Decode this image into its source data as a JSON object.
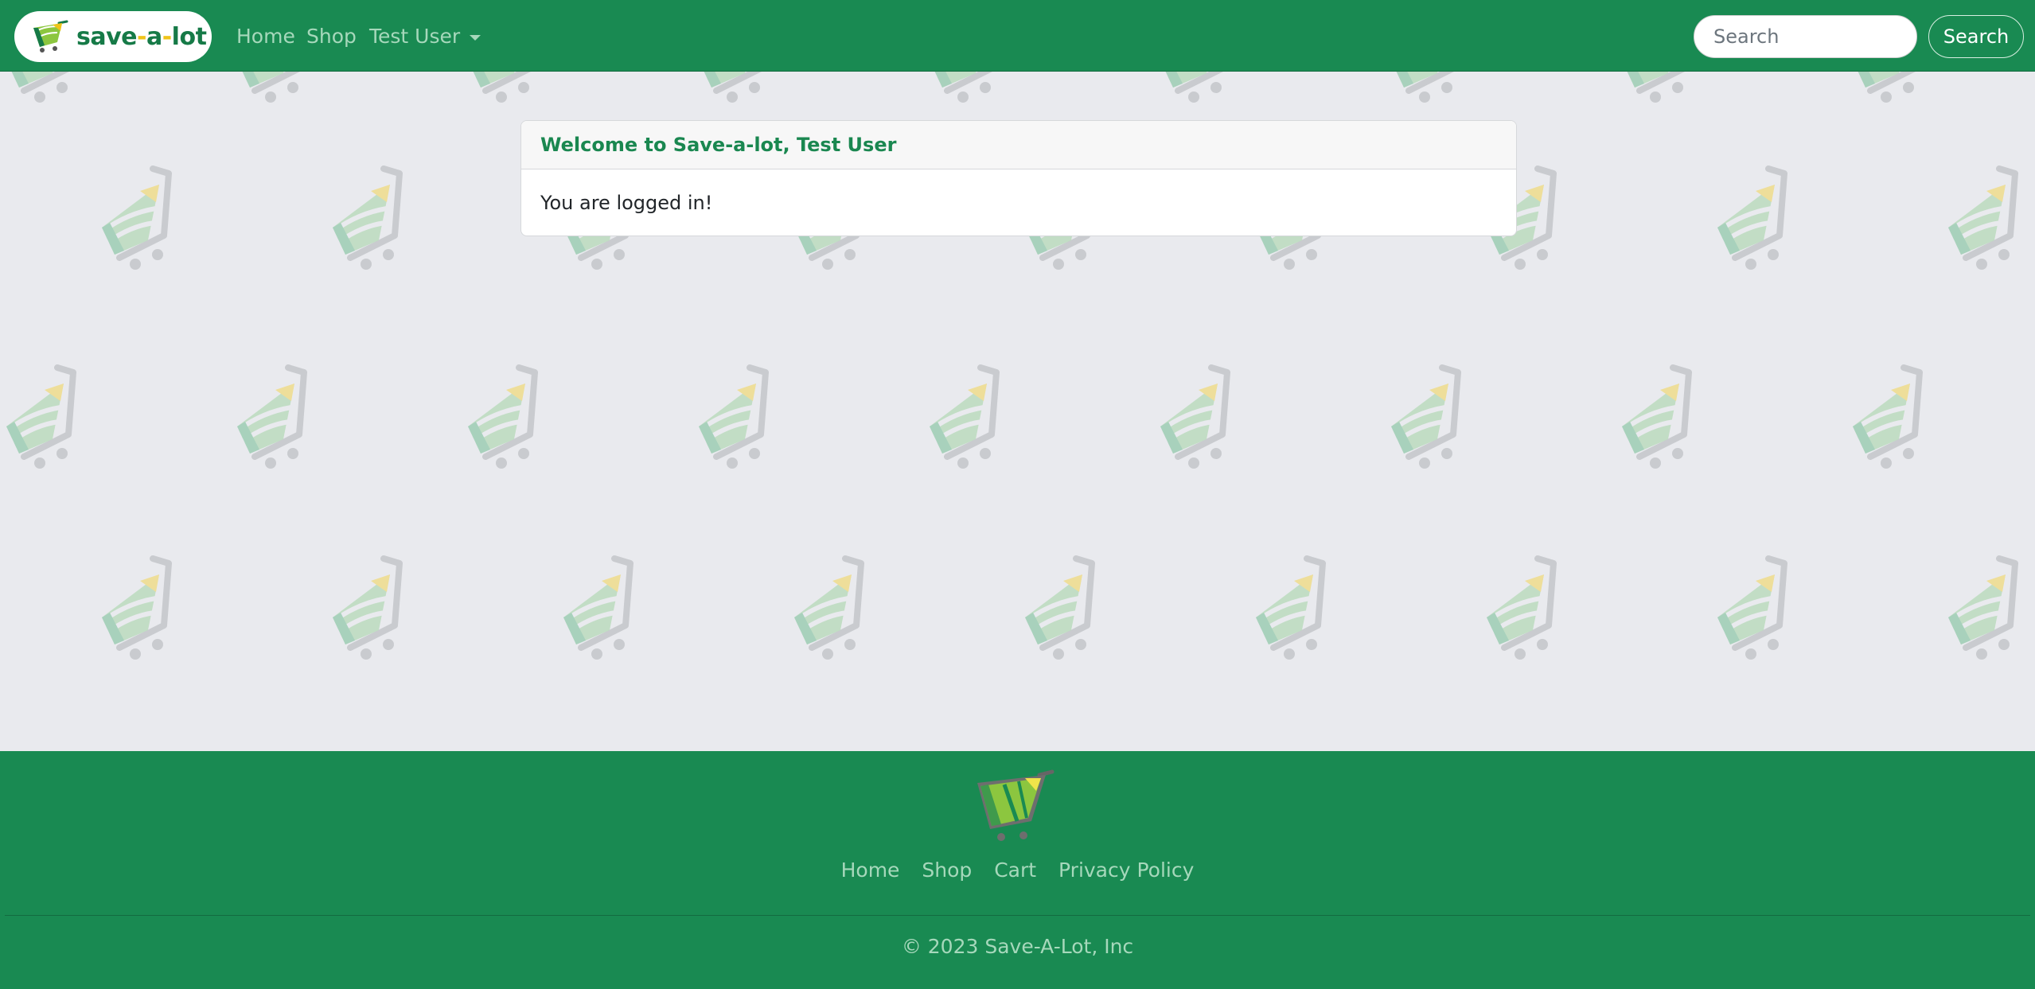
{
  "navbar": {
    "brand_text_left": "save",
    "brand_text_dash1": "-",
    "brand_text_mid": "a",
    "brand_text_dash2": "-",
    "brand_text_right": "lot",
    "links": {
      "home": "Home",
      "shop": "Shop",
      "user": "Test User"
    },
    "search": {
      "placeholder": "Search",
      "value": "",
      "button_label": "Search"
    }
  },
  "card": {
    "header": "Welcome to Save-a-lot, Test User",
    "body": "You are logged in!"
  },
  "footer": {
    "links": {
      "home": "Home",
      "shop": "Shop",
      "cart": "Cart",
      "privacy": "Privacy Policy"
    },
    "copyright": "© 2023 Save-A-Lot, Inc"
  },
  "colors": {
    "primary": "#198a52",
    "nav_link": "#a6d8bb",
    "page_bg": "#e9eaee",
    "accent_yellow": "#f0c419"
  },
  "icons": {
    "brand_logo": "shopping-cart-logo",
    "background_pattern": "shopping-cart-icon",
    "dropdown": "caret-down-icon"
  }
}
